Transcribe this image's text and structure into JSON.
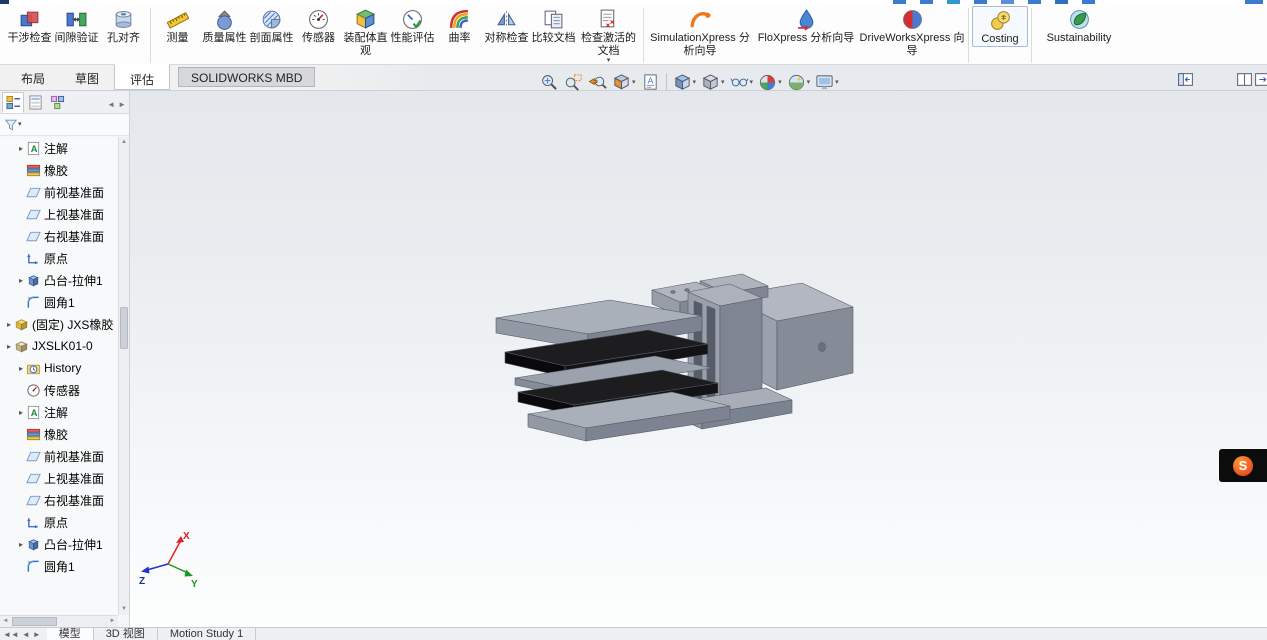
{
  "titlebar": {
    "icons": [
      "titlebar-icon-1",
      "titlebar-icon-2",
      "titlebar-icon-3",
      "titlebar-icon-4",
      "titlebar-icon-5",
      "titlebar-icon-6",
      "titlebar-icon-7",
      "titlebar-icon-8"
    ]
  },
  "ribbon": {
    "buttons": [
      {
        "label": "干涉检查",
        "icon": "interference-check"
      },
      {
        "label": "间隙验证",
        "icon": "clearance-verification"
      },
      {
        "label": "孔对齐",
        "icon": "hole-alignment"
      },
      {
        "label": "测量",
        "icon": "measure"
      },
      {
        "label": "质量属性",
        "icon": "mass-properties"
      },
      {
        "label": "剖面属性",
        "icon": "section-properties"
      },
      {
        "label": "传感器",
        "icon": "sensor"
      },
      {
        "label": "装配体直观",
        "icon": "assembly-visualization"
      },
      {
        "label": "性能评估",
        "icon": "performance-evaluation"
      },
      {
        "label": "曲率",
        "icon": "curvature"
      },
      {
        "label": "对称检查",
        "icon": "symmetry-check"
      },
      {
        "label": "比较文档",
        "icon": "compare-documents"
      },
      {
        "label": "检查激活的文档",
        "icon": "check-active-document",
        "dropdown": true
      },
      {
        "label": "SimulationXpress 分析向导",
        "icon": "simulationxpress-wizard"
      },
      {
        "label": "FloXpress 分析向导",
        "icon": "floxpress-wizard"
      },
      {
        "label": "DriveWorksXpress 向导",
        "icon": "driveworksxpress-wizard"
      },
      {
        "label": "Costing",
        "icon": "costing"
      },
      {
        "label": "Sustainability",
        "icon": "sustainability"
      }
    ]
  },
  "command_tabs": {
    "items": [
      {
        "label": "布局"
      },
      {
        "label": "草图"
      },
      {
        "label": "评估",
        "active": true
      },
      {
        "label": "SOLIDWORKS MBD"
      }
    ]
  },
  "headsup": {
    "icons": [
      {
        "name": "zoom-to-fit"
      },
      {
        "name": "zoom-to-area"
      },
      {
        "name": "previous-view"
      },
      {
        "name": "section-view",
        "dropdown": true
      },
      {
        "name": "dynamic-annotation-views"
      },
      {
        "name": "view-orientation",
        "dropdown": true
      },
      {
        "name": "display-style",
        "dropdown": true
      },
      {
        "name": "hide-show-items",
        "dropdown": true
      },
      {
        "name": "edit-appearance",
        "dropdown": true
      },
      {
        "name": "apply-scene",
        "dropdown": true
      },
      {
        "name": "view-settings",
        "dropdown": true
      }
    ]
  },
  "pane_controls": {
    "icons": [
      "featuremanager-expand",
      "display-pane",
      "collapse-ribbon"
    ]
  },
  "feature_tree": {
    "header_tabs": [
      "featuremanager-design-tree",
      "propertymanager",
      "configurationmanager"
    ],
    "filter": {
      "icon": "filter-funnel",
      "value": ""
    },
    "items": [
      {
        "label": "注解",
        "expandable": true
      },
      {
        "label": "橡胶"
      },
      {
        "label": "前视基准面"
      },
      {
        "label": "上视基准面"
      },
      {
        "label": "右视基准面"
      },
      {
        "label": "原点"
      },
      {
        "label": "凸台-拉伸1",
        "expandable": true
      },
      {
        "label": "圆角1"
      },
      {
        "label": "(固定) JXS橡胶",
        "expandable": true
      },
      {
        "label": "JXSLK01-0",
        "expandable": true
      },
      {
        "label": "History",
        "expandable": true
      },
      {
        "label": "传感器"
      },
      {
        "label": "注解",
        "expandable": true
      },
      {
        "label": "橡胶"
      },
      {
        "label": "前视基准面"
      },
      {
        "label": "上视基准面"
      },
      {
        "label": "右视基准面"
      },
      {
        "label": "原点"
      },
      {
        "label": "凸台-拉伸1",
        "expandable": true
      },
      {
        "label": "圆角1"
      }
    ]
  },
  "viewport": {
    "model": "gray-gripper-assembly",
    "triad": {
      "x_label": "X",
      "y_label": "Y",
      "z_label": "Z"
    }
  },
  "banner": {
    "logo_text": "S"
  },
  "bottom_tabs": {
    "items": [
      {
        "label": "模型",
        "active": true
      },
      {
        "label": "3D 视图"
      },
      {
        "label": "Motion Study 1"
      }
    ]
  },
  "colors": {
    "accent_blue": "#2e6fc0",
    "viewport_top": "#e4e8ec",
    "viewport_bottom": "#fdfefe",
    "model_gray": "#9aa0ac",
    "rubber_black": "#161618",
    "banner_bg": "#0c0c0c",
    "banner_logo": "#f07020"
  }
}
